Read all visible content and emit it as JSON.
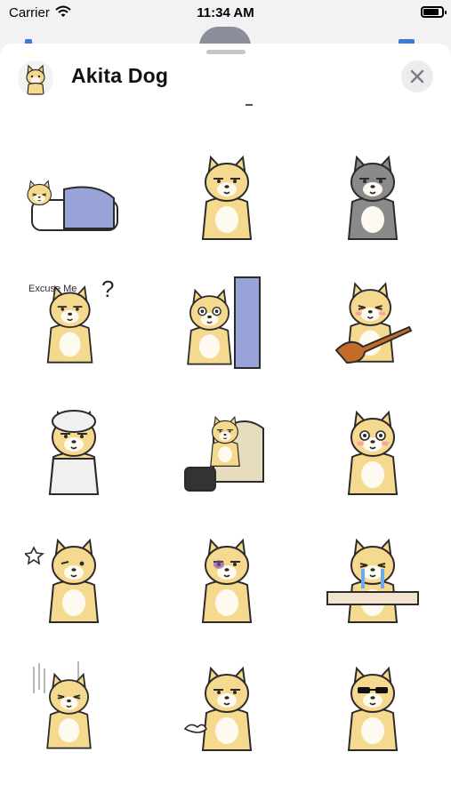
{
  "status_bar": {
    "carrier": "Carrier",
    "time": "11:34 AM",
    "battery_level": 0.85
  },
  "sheet": {
    "title": "Akita Dog"
  },
  "colors": {
    "fur": "#f5d98e",
    "outline": "#2b2b2b",
    "cream": "#fffaf0",
    "blush": "#f5a3a3",
    "accent": "#9aa3d8"
  },
  "icons": {
    "close": "close-icon",
    "wifi": "wifi-icon",
    "battery": "battery-icon",
    "app": "akita-app-icon"
  },
  "stickers": [
    {
      "name": "sleeping-in-bed"
    },
    {
      "name": "neutral-stare"
    },
    {
      "name": "gray-shadowed"
    },
    {
      "name": "excuse-me",
      "text": "Excuse Me",
      "mark": "?"
    },
    {
      "name": "peeking-door"
    },
    {
      "name": "playing-guitar"
    },
    {
      "name": "towel-bathrobe"
    },
    {
      "name": "armchair-tv"
    },
    {
      "name": "shocked-cover-mouth"
    },
    {
      "name": "winking"
    },
    {
      "name": "bruised-eye"
    },
    {
      "name": "crying-desk"
    },
    {
      "name": "rain-sad"
    },
    {
      "name": "sighing"
    },
    {
      "name": "sunglasses-cool"
    }
  ]
}
